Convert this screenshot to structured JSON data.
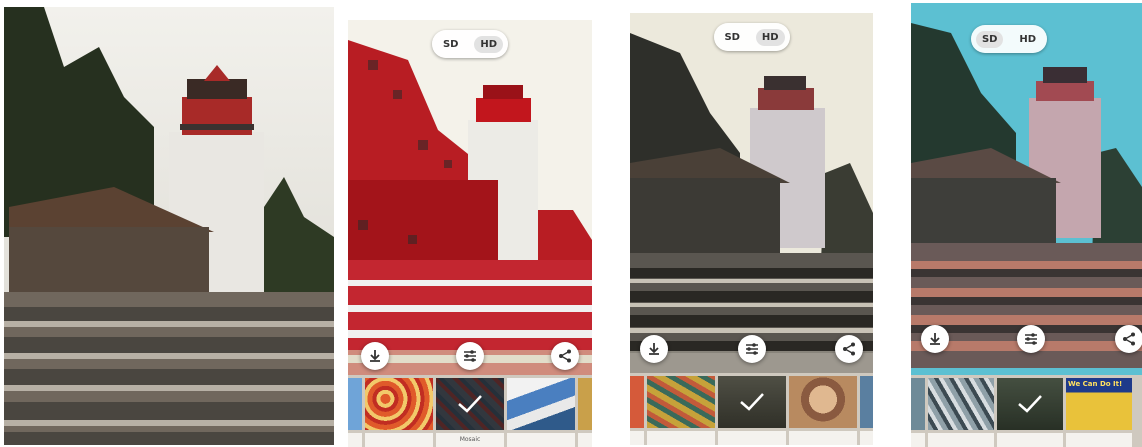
{
  "toggle": {
    "sd": "SD",
    "hd": "HD"
  },
  "panels": [
    {
      "name": "original-photo",
      "toggle": false
    },
    {
      "name": "styled-preview-red-mosaic",
      "selected": "hd",
      "thumbs": [
        {
          "label": "",
          "color": "#6fa4d8"
        },
        {
          "label": "",
          "color": "#d84a2a"
        },
        {
          "label": "Mosaic",
          "color": "#4e5560",
          "selected": true
        },
        {
          "label": "",
          "color": "#4a7fc0"
        },
        {
          "label": "",
          "color": "#c9a04a"
        }
      ]
    },
    {
      "name": "styled-preview-sketch",
      "selected": "hd",
      "thumbs": [
        {
          "label": "",
          "color": "#d55a3a"
        },
        {
          "label": "",
          "color": "#c6a23a"
        },
        {
          "label": "",
          "color": "#6a6a5a",
          "selected": true
        },
        {
          "label": "",
          "color": "#b88a60"
        },
        {
          "label": "",
          "color": "#5a7fa0"
        }
      ]
    },
    {
      "name": "styled-preview-cyan",
      "selected": "sd",
      "thumbs": [
        {
          "label": "",
          "color": "#6e8a98"
        },
        {
          "label": "",
          "color": "#8fa0a8"
        },
        {
          "label": "",
          "color": "#5a6a58",
          "selected": true
        },
        {
          "label": "",
          "color": "#d0a030"
        }
      ]
    }
  ],
  "last_thumb_caption": "We Can Do It!",
  "colors": {
    "accent": "#ffffff",
    "strip": "#cfc9bf"
  }
}
